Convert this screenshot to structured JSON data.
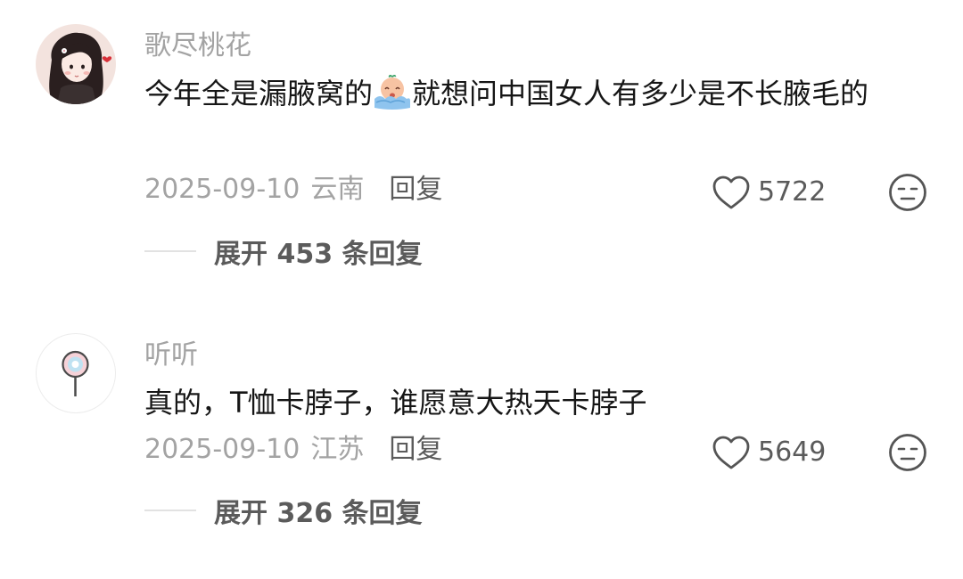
{
  "comments": [
    {
      "username": "歌尽桃花",
      "text_before": "今年全是漏腋窝的",
      "emoji": "crying-emoji",
      "text_after": "就想问中国女人有多少是不长腋毛的",
      "date": "2025-09-10",
      "location": "云南",
      "reply_label": "回复",
      "likes": "5722",
      "expand_label": "展开 453 条回复",
      "avatar": "girl-avatar"
    },
    {
      "username": "听听",
      "text": "真的，T恤卡脖子，谁愿意大热天卡脖子",
      "date": "2025-09-10",
      "location": "江苏",
      "reply_label": "回复",
      "likes": "5649",
      "expand_label": "展开 326 条回复",
      "avatar": "lollipop-avatar"
    }
  ],
  "colors": {
    "text": "#161616",
    "muted": "#a3a3a3",
    "secondary": "#5b5b5b",
    "background": "#ffffff"
  },
  "icons": {
    "like": "heart-outline-icon",
    "dislike": "meh-face-icon"
  }
}
